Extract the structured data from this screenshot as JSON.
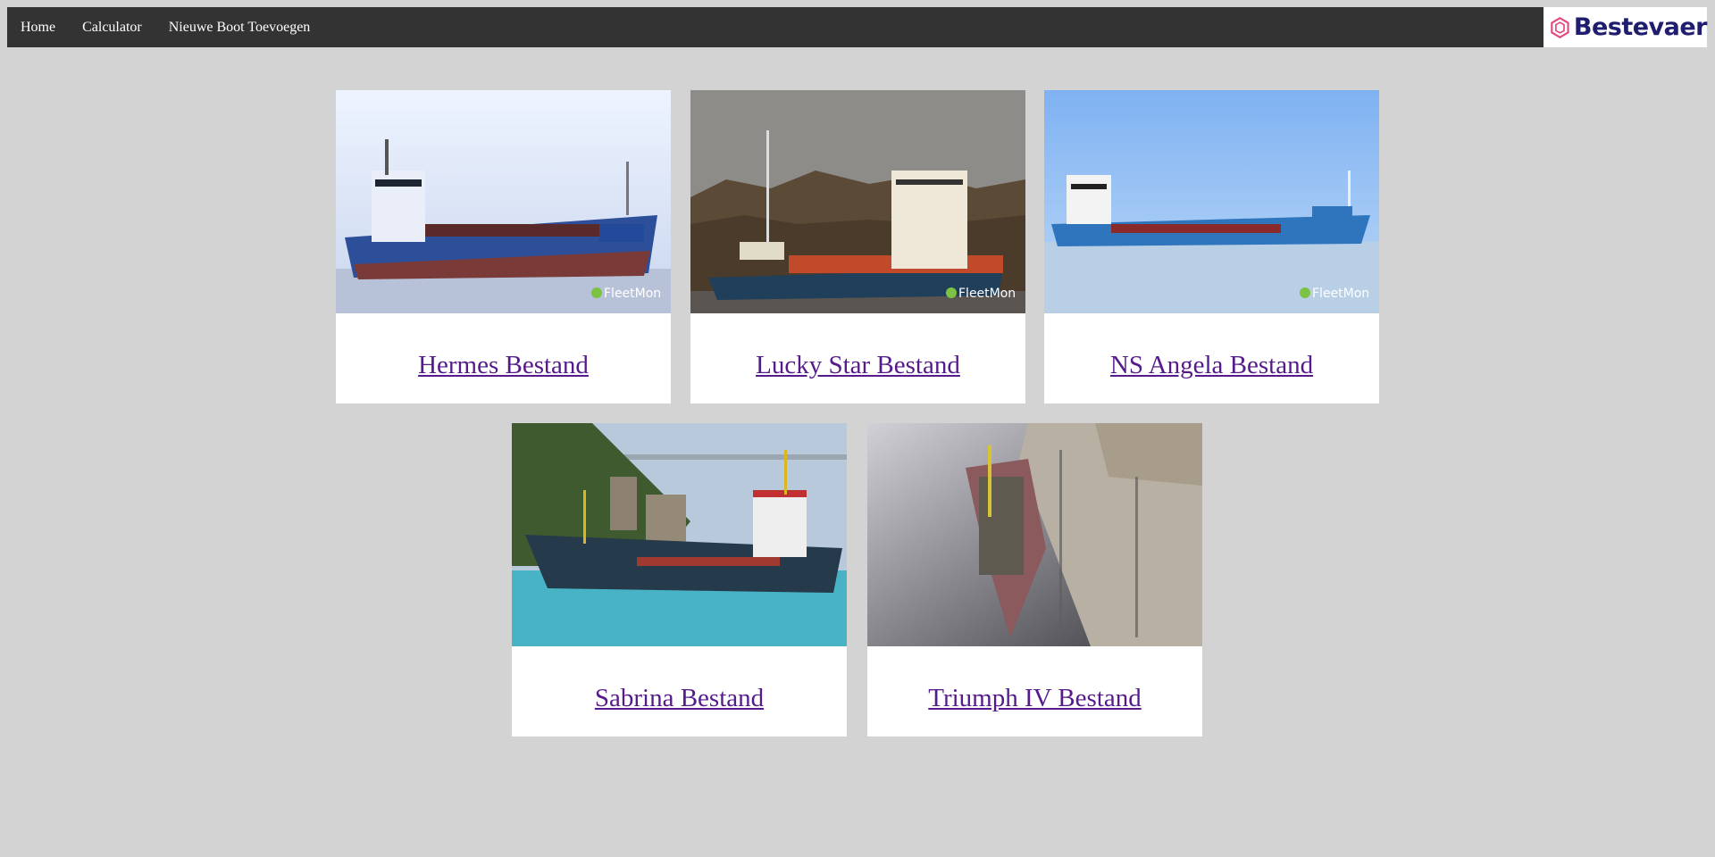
{
  "nav": {
    "items": [
      "Home",
      "Calculator",
      "Nieuwe Boot Toevoegen"
    ]
  },
  "brand": {
    "name": "Bestevaer",
    "color": "#1f1d6e",
    "accent": "#e5457a"
  },
  "boats": [
    {
      "title": "Hermes Bestand",
      "watermark": "FleetMon"
    },
    {
      "title": "Lucky Star Bestand",
      "watermark": "FleetMon"
    },
    {
      "title": "NS Angela Bestand",
      "watermark": "FleetMon"
    },
    {
      "title": "Sabrina Bestand"
    },
    {
      "title": "Triumph IV Bestand"
    }
  ],
  "colors": {
    "page_background": "#d3d3d3",
    "navbar": "#333333",
    "link_visited": "#551a8b"
  }
}
